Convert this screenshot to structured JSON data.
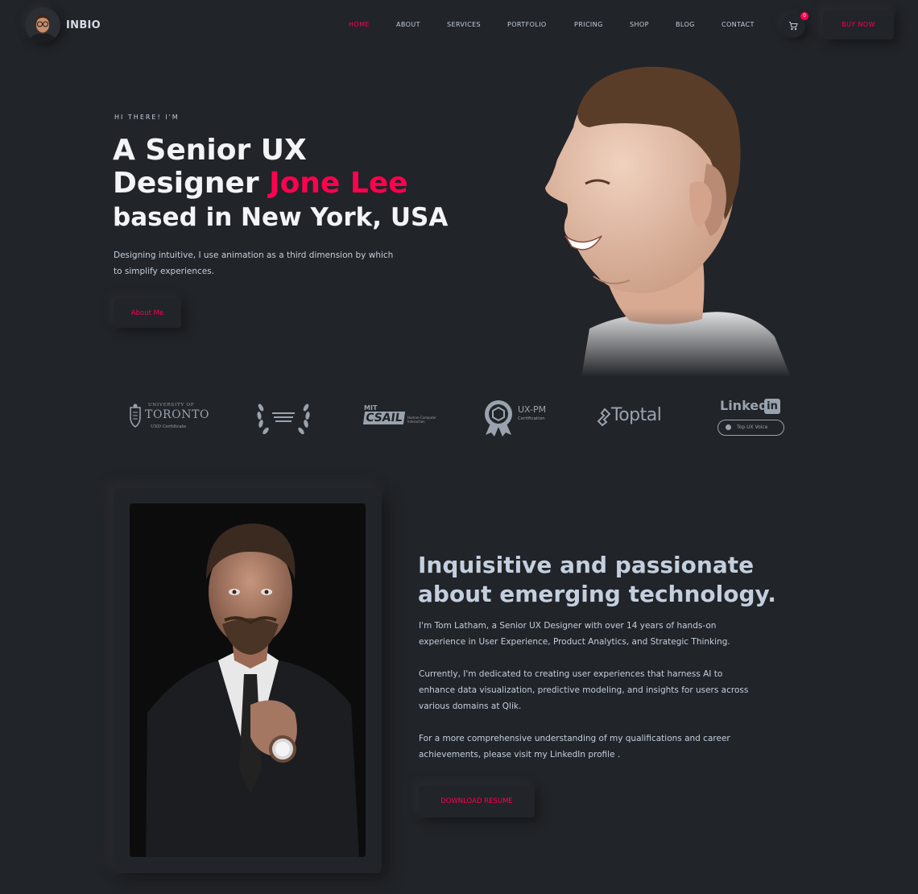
{
  "brand": {
    "name": "INBIO"
  },
  "nav": {
    "items": [
      {
        "label": "HOME",
        "active": true
      },
      {
        "label": "ABOUT"
      },
      {
        "label": "SERVICES"
      },
      {
        "label": "PORTFOLIO"
      },
      {
        "label": "PRICING"
      },
      {
        "label": "SHOP"
      },
      {
        "label": "BLOG"
      },
      {
        "label": "CONTACT"
      }
    ],
    "cart_icon": "cart-icon",
    "cart_count": "0",
    "buy_label": "BUY NOW"
  },
  "hero": {
    "greeting": "HI THERE! I'M",
    "title_part1": "A Senior UX",
    "title_part2": "Designer ",
    "title_name": "Jone Lee",
    "title_line3": "based in New York, USA",
    "description": "Designing intuitive, I use animation as a third dimension by which to simplify experiences.",
    "button_label": "About Me"
  },
  "credentials": {
    "toronto": {
      "line1": "UNIVERSITY OF",
      "line2": "TORONTO",
      "line3": "UXD Certificate"
    },
    "mit": {
      "line1": "MIT",
      "line2": "CSAIL",
      "line3": "Human-Computer Interaction"
    },
    "uxpm": {
      "line1": "UX-PM",
      "line2": "Certification"
    },
    "toptal": {
      "label": "Toptal"
    },
    "linkedin": {
      "label": "Linked",
      "badge": "Top UX Voice"
    }
  },
  "about": {
    "heading": "Inquisitive and passionate about emerging technology.",
    "paragraph1": "I'm Tom Latham, a Senior UX Designer with over 14 years of hands-on experience in User Experience, Product Analytics, and Strategic Thinking.",
    "paragraph2": "Currently, I'm dedicated to creating user experiences that harness AI to enhance data visualization, predictive modeling, and insights for users across various domains at Qlik.",
    "paragraph3": "For a more comprehensive understanding of my qualifications and career achievements, please visit my LinkedIn profile .",
    "resume_label": "DOWNLOAD RESUME"
  },
  "colors": {
    "accent": "#ff014f",
    "background": "#212428",
    "text": "#c4cfde"
  }
}
